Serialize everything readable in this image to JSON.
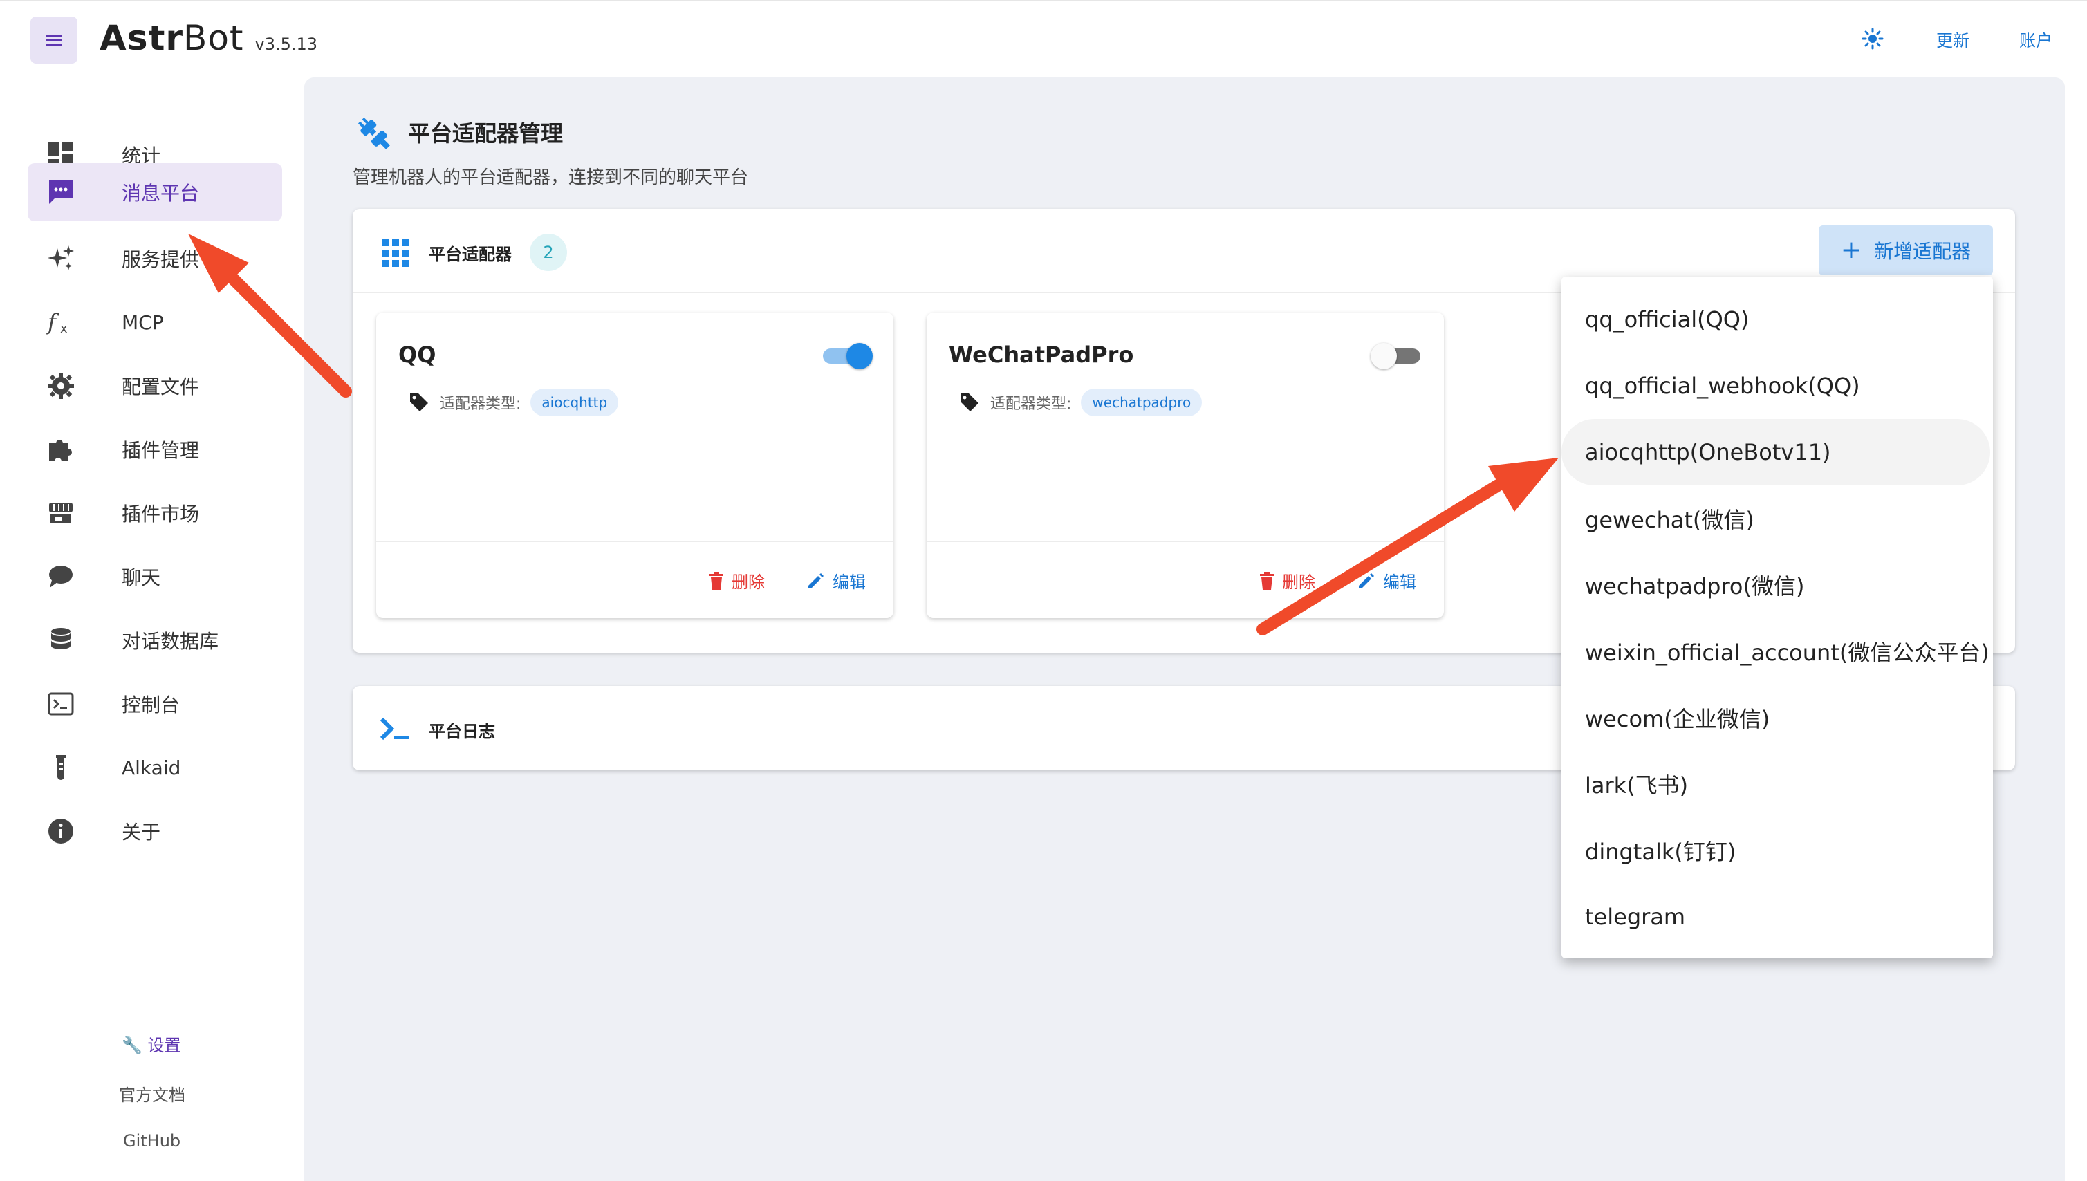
{
  "app": {
    "name_bold": "Astr",
    "name_regular": "Bot",
    "version": "v3.5.13"
  },
  "topbar": {
    "update_label": "更新",
    "account_label": "账户",
    "theme_icon": "sun-icon"
  },
  "sidebar": {
    "items": [
      {
        "label": "统计",
        "icon": "dashboard-icon"
      },
      {
        "label": "消息平台",
        "icon": "message-icon",
        "active": true
      },
      {
        "label": "服务提供",
        "icon": "sparkle-icon"
      },
      {
        "label": "MCP",
        "icon": "function-icon"
      },
      {
        "label": "配置文件",
        "icon": "gear-icon"
      },
      {
        "label": "插件管理",
        "icon": "puzzle-icon"
      },
      {
        "label": "插件市场",
        "icon": "store-icon"
      },
      {
        "label": "聊天",
        "icon": "chat-icon"
      },
      {
        "label": "对话数据库",
        "icon": "database-icon"
      },
      {
        "label": "控制台",
        "icon": "console-icon"
      },
      {
        "label": "Alkaid",
        "icon": "flask-icon"
      },
      {
        "label": "关于",
        "icon": "info-icon"
      }
    ],
    "footer": {
      "settings": "🔧 设置",
      "docs": "官方文档",
      "github": "GitHub"
    }
  },
  "page": {
    "title": "平台适配器管理",
    "subtitle": "管理机器人的平台适配器，连接到不同的聊天平台"
  },
  "adapters_card": {
    "title": "平台适配器",
    "count": "2",
    "add_button": "新增适配器",
    "type_label": "适配器类型:",
    "delete_label": "删除",
    "edit_label": "编辑",
    "adapters": [
      {
        "name": "QQ",
        "type": "aiocqhttp",
        "enabled": true
      },
      {
        "name": "WeChatPadPro",
        "type": "wechatpadpro",
        "enabled": false
      }
    ]
  },
  "log_card": {
    "title": "平台日志"
  },
  "dropdown": {
    "items": [
      "qq_official(QQ)",
      "qq_official_webhook(QQ)",
      "aiocqhttp(OneBotv11)",
      "gewechat(微信)",
      "wechatpadpro(微信)",
      "weixin_official_account(微信公众平台)",
      "wecom(企业微信)",
      "lark(飞书)",
      "dingtalk(钉钉)",
      "telegram"
    ],
    "highlighted_index": 2
  },
  "colors": {
    "accent": "#1976d2",
    "sidebar_active_bg": "#ece6f6",
    "sidebar_active_text": "#5e35b1",
    "danger": "#e53935",
    "annotation_arrow": "#f04a2a"
  }
}
